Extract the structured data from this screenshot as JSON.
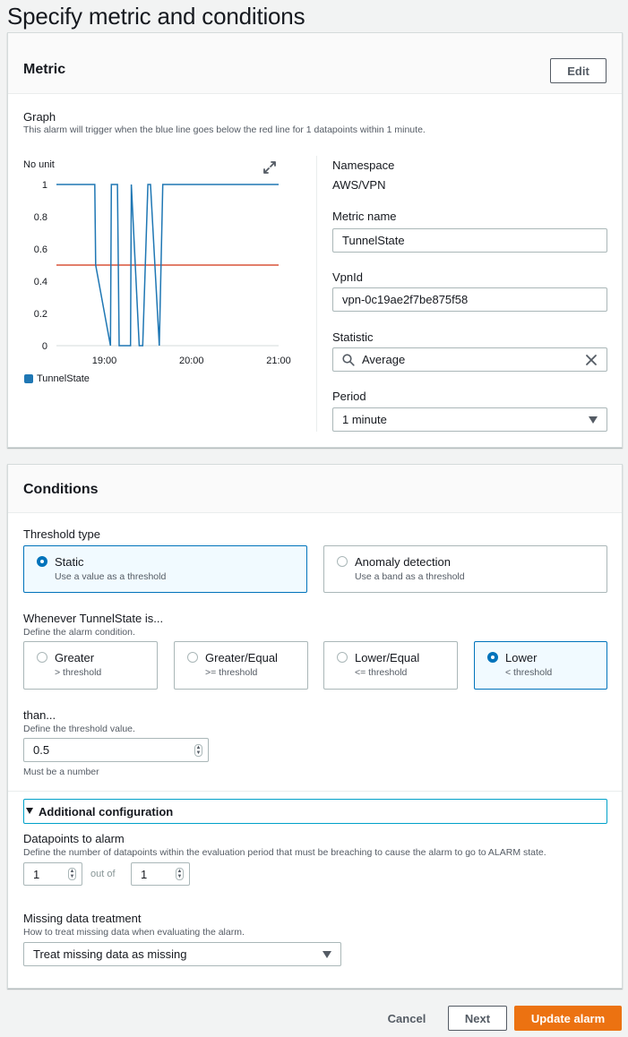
{
  "page": {
    "title": "Specify metric and conditions"
  },
  "metric": {
    "title": "Metric",
    "edit_label": "Edit",
    "graph_label": "Graph",
    "graph_desc": "This alarm will trigger when the blue line goes below the red line for 1 datapoints within 1 minute.",
    "unit_label": "No unit",
    "legend_label": "TunnelState",
    "namespace_label": "Namespace",
    "namespace_value": "AWS/VPN",
    "metric_name_label": "Metric name",
    "metric_name_value": "TunnelState",
    "vpnid_label": "VpnId",
    "vpnid_value": "vpn-0c19ae2f7be875f58",
    "statistic_label": "Statistic",
    "statistic_value": "Average",
    "period_label": "Period",
    "period_value": "1 minute"
  },
  "chart_data": {
    "type": "line",
    "ylim": [
      0,
      1
    ],
    "yticks": [
      "1",
      "0.8",
      "0.6",
      "0.4",
      "0.2",
      "0"
    ],
    "xticks": [
      "19:00",
      "20:00",
      "21:00"
    ],
    "series": [
      {
        "name": "TunnelState",
        "color": "#1f77b4",
        "x": [
          18.45,
          18.89,
          18.9,
          19.07,
          19.08,
          19.15,
          19.17,
          19.3,
          19.31,
          19.4,
          19.44,
          19.5,
          19.53,
          19.63,
          19.67,
          21.0
        ],
        "values": [
          1,
          1,
          0.5,
          0,
          1,
          1,
          0,
          0,
          1,
          0,
          0,
          1,
          1,
          0,
          1,
          1
        ]
      }
    ],
    "threshold": {
      "value": 0.5,
      "color": "#d13212"
    },
    "xlim": [
      18.45,
      21.0
    ]
  },
  "conditions": {
    "title": "Conditions",
    "threshold_type_label": "Threshold type",
    "static_title": "Static",
    "static_sub": "Use a value as a threshold",
    "anomaly_title": "Anomaly detection",
    "anomaly_sub": "Use a band as a threshold",
    "whenever_label": "Whenever TunnelState is...",
    "whenever_desc": "Define the alarm condition.",
    "options": [
      {
        "title": "Greater",
        "sub": "> threshold"
      },
      {
        "title": "Greater/Equal",
        "sub": ">= threshold"
      },
      {
        "title": "Lower/Equal",
        "sub": "<= threshold"
      },
      {
        "title": "Lower",
        "sub": "< threshold"
      }
    ],
    "than_label": "than...",
    "than_desc": "Define the threshold value.",
    "threshold_value": "0.5",
    "threshold_hint": "Must be a number",
    "additional_label": "Additional configuration",
    "datapoints_label": "Datapoints to alarm",
    "datapoints_desc": "Define the number of datapoints within the evaluation period that must be breaching to cause the alarm to go to ALARM state.",
    "datapoints_value": "1",
    "out_of_label": "out of",
    "period_count_value": "1",
    "missing_label": "Missing data treatment",
    "missing_desc": "How to treat missing data when evaluating the alarm.",
    "missing_value": "Treat missing data as missing"
  },
  "footer": {
    "cancel_label": "Cancel",
    "next_label": "Next",
    "update_label": "Update alarm"
  }
}
